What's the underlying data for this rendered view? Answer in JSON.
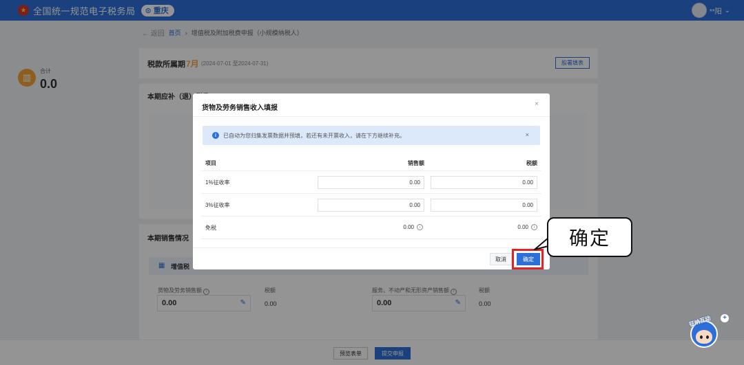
{
  "header": {
    "site_title": "全国统一规范电子税务局",
    "region": "重庆",
    "user_name": "**阳"
  },
  "breadcrumb": {
    "back": "返回",
    "home": "首页",
    "current": "增值税及附加税费申报（小规模纳税人）"
  },
  "period": {
    "label": "税款所属期",
    "month": "7月",
    "range": "(2024-07-01 至2024-07-31)",
    "guide_button": "股署填表"
  },
  "due": {
    "title": "本期应补（退）税费",
    "total_label": "合计",
    "total_value": "0.0"
  },
  "sales": {
    "title": "本期销售情况",
    "band_label": "增值税",
    "goods_label": "货物及劳务销售额",
    "goods_value": "0.00",
    "goods_tax_label": "税额",
    "goods_tax_value": "0.00",
    "service_label": "服务、不动产和无形资产销售额",
    "service_value": "0.00",
    "service_tax_label": "税额",
    "service_tax_value": "0.00"
  },
  "footer": {
    "preview": "预览表单",
    "submit": "提交申报"
  },
  "modal": {
    "title": "货物及劳务销售收入填报",
    "close": "×",
    "alert_text": "已自动为您归集发票数据并预填，若还有未开票收入，请在下方继续补充。",
    "alert_close": "×",
    "columns": {
      "item": "项目",
      "sales": "销售额",
      "tax": "税额"
    },
    "rows": [
      {
        "item": "1%征收率",
        "sales": "0.00",
        "tax": "0.00"
      },
      {
        "item": "3%征收率",
        "sales": "0.00",
        "tax": "0.00"
      },
      {
        "item": "免税",
        "sales": "0.00",
        "tax": "0.00"
      }
    ],
    "cancel": "取消",
    "confirm": "确定"
  },
  "callout": {
    "text": "确定"
  },
  "mascot": {
    "label": "征纳互动"
  },
  "colors": {
    "primary": "#2d6fd8",
    "accent": "#f2a43a",
    "highlight": "#e52222"
  }
}
